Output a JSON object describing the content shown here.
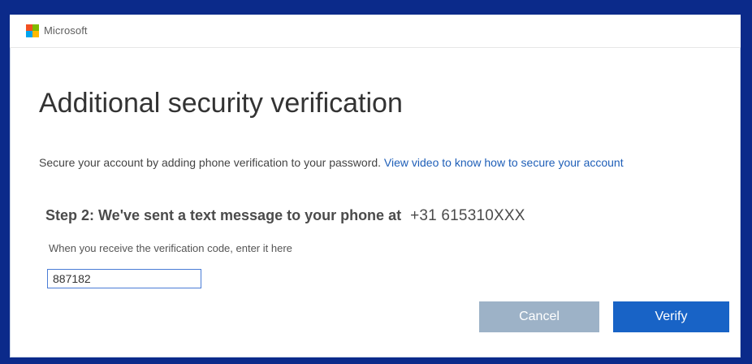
{
  "header": {
    "brand": "Microsoft",
    "logo_colors": [
      "#f25022",
      "#7fba00",
      "#00a4ef",
      "#ffb900"
    ]
  },
  "main": {
    "title": "Additional security verification",
    "intro_text": "Secure your account by adding phone verification to your password.",
    "intro_link": "View video to know how to secure your account",
    "step_label": "Step 2: We've sent a text message to your phone at",
    "phone_number": "+31 615310XXX",
    "instruction": "When you receive the verification code, enter it here",
    "code_value": "887182",
    "cancel_label": "Cancel",
    "verify_label": "Verify"
  },
  "colors": {
    "frame": "#0b2a8a",
    "link": "#1f5fb8",
    "verify_button": "#1863c6",
    "cancel_button": "#9db2c7"
  }
}
